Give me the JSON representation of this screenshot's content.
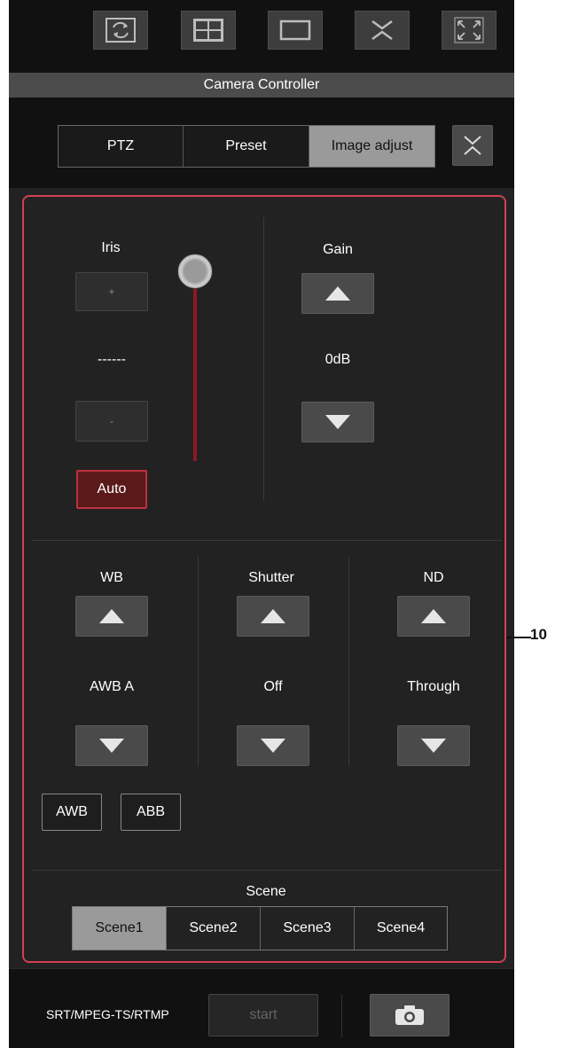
{
  "toolbar": {
    "icons": [
      "refresh-screen-icon",
      "multi-screen-icon",
      "single-screen-icon",
      "collapse-toggle-icon",
      "fullscreen-icon"
    ]
  },
  "header": {
    "title": "Camera Controller"
  },
  "tabs": [
    {
      "label": "PTZ",
      "active": false
    },
    {
      "label": "Preset",
      "active": false
    },
    {
      "label": "Image adjust",
      "active": true
    }
  ],
  "iris": {
    "label": "Iris",
    "plus_label": "+",
    "value": "------",
    "minus_label": "-",
    "auto_label": "Auto"
  },
  "gain": {
    "label": "Gain",
    "value": "0dB"
  },
  "wb": {
    "label": "WB",
    "value": "AWB A"
  },
  "shutter": {
    "label": "Shutter",
    "value": "Off"
  },
  "nd": {
    "label": "ND",
    "value": "Through"
  },
  "white_buttons": {
    "awb_label": "AWB",
    "abb_label": "ABB"
  },
  "scene": {
    "label": "Scene",
    "items": [
      "Scene1",
      "Scene2",
      "Scene3",
      "Scene4"
    ],
    "selected": "Scene1"
  },
  "footer": {
    "stream_label": "SRT/MPEG-TS/RTMP",
    "start_label": "start"
  },
  "callout": {
    "label": "10"
  },
  "colors": {
    "panel_bg": "#111111",
    "section_bg": "#222222",
    "button_bg": "#4a4a4a",
    "active_tab": "#9a9a9a",
    "auto_button": "#5a1a1a",
    "callout_border": "#d04050"
  }
}
